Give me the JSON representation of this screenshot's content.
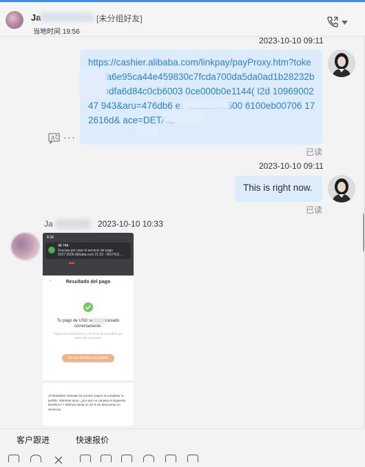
{
  "header": {
    "contact_name": "Ja",
    "contact_tag": "[未分组好友]",
    "local_time": "当地时间 19:56"
  },
  "messages": [
    {
      "timestamp": "2023-10-10 09:11",
      "link_text": "https://cashier.alibaba.com/linkpay/payProxy.htm?token=afa6e95ca44e459830c7fcda700da5da0ad1b28232b63dbdfa6d84c0cb6003 0ce000b0e1144( I2d 1096900247 943&aru=476db6 e942a12001500 6100eb00706 172616d& ace=DETAIL",
      "read_status": "已读"
    },
    {
      "timestamp": "2023-10-10 09:11",
      "text": "This is right now.",
      "read_status": "已读"
    },
    {
      "sender": "Ja",
      "timestamp": "2023-10-10 10:33",
      "screenshot": {
        "time": "9:32",
        "notification_title": "46 744",
        "notification_line1": "Gracias por usar el servicio de pago",
        "notification_line2": "6027 2006 Alibaba.com 21:33 - RGYGQ ...",
        "page_title": "Resultado del pago",
        "paid_text": "Tu pago de USD    se ha procesado correctamente.",
        "note": "Espera la confirmación y el envío de tu pedido por parte del proveedor",
        "order_button": "Ver los detalles del pedido",
        "bottom_text": "¡Felicidades! Ganaste 61 puntos canjes al completar tu pedido. Mientras tanto, ¿por qué no canjeas el siguiente beneficio? • Disfruta hasta un 10 % de descuento en Servicios"
      }
    }
  ],
  "bottom_tabs": {
    "tab1": "客户跟进",
    "tab2": "快速报价"
  },
  "icons": [
    "phone-icon",
    "chevron-down-icon",
    "translate-icon",
    "more-icon",
    "check-icon"
  ],
  "colors": {
    "bubble": "#dcecfb",
    "link": "#2a7fd4",
    "accent": "#3d8bf2"
  }
}
